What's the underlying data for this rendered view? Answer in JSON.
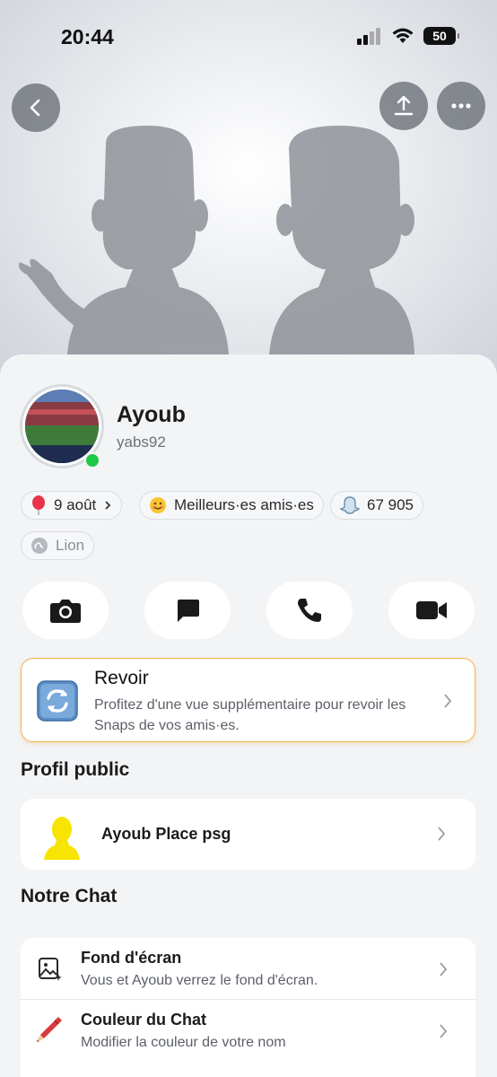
{
  "status_bar": {
    "time": "20:44",
    "battery": "50"
  },
  "profile": {
    "name": "Ayoub",
    "username": "yabs92"
  },
  "chips": [
    {
      "icon": "balloon-icon",
      "label": "9 août"
    },
    {
      "icon": "smile-icon",
      "label": "Meilleurs·es amis·es"
    },
    {
      "icon": "ghost-icon",
      "label": "67 905"
    },
    {
      "icon": "leo-icon",
      "label": "Lion"
    }
  ],
  "revoir": {
    "title": "Revoir",
    "description": "Profitez d'une vue supplémentaire pour revoir les Snaps de vos amis·es."
  },
  "public_profile": {
    "section_title": "Profil public",
    "item_label": "Ayoub Place psg"
  },
  "our_chat": {
    "section_title": "Notre Chat",
    "items": [
      {
        "title": "Fond d'écran",
        "description": "Vous et Ayoub verrez le fond d'écran."
      },
      {
        "title": "Couleur du Chat",
        "description": "Modifier la couleur de votre nom"
      }
    ]
  },
  "colors": {
    "accent_online": "#20c84a",
    "revoir_border": "#f2b44a",
    "bitmoji_yellow": "#f7e400"
  }
}
